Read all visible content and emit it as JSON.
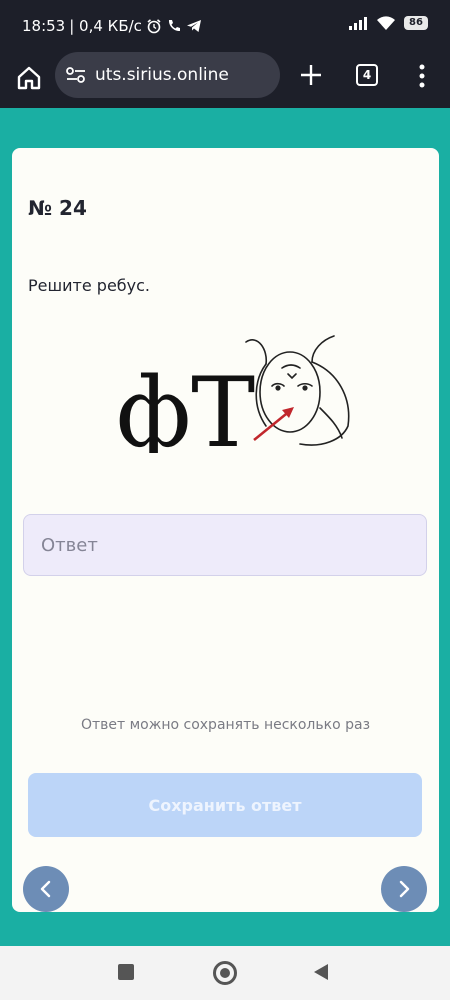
{
  "status_bar": {
    "time": "18:53",
    "speed": "| 0,4 КБ/с",
    "battery": "86"
  },
  "browser": {
    "url": "uts.sirius.online",
    "tab_count": "4"
  },
  "question": {
    "number": "№ 24",
    "prompt": "Решите ребус.",
    "rebus_text": "фТ"
  },
  "answer": {
    "placeholder": "Ответ",
    "value": ""
  },
  "hint": "Ответ можно сохранять несколько раз",
  "save_button": "Сохранить ответ",
  "colors": {
    "background": "#1aafa3",
    "save_button_disabled": "#bcd5f8",
    "nav_button": "#6d8db6",
    "input_bg": "#eeebfa"
  }
}
